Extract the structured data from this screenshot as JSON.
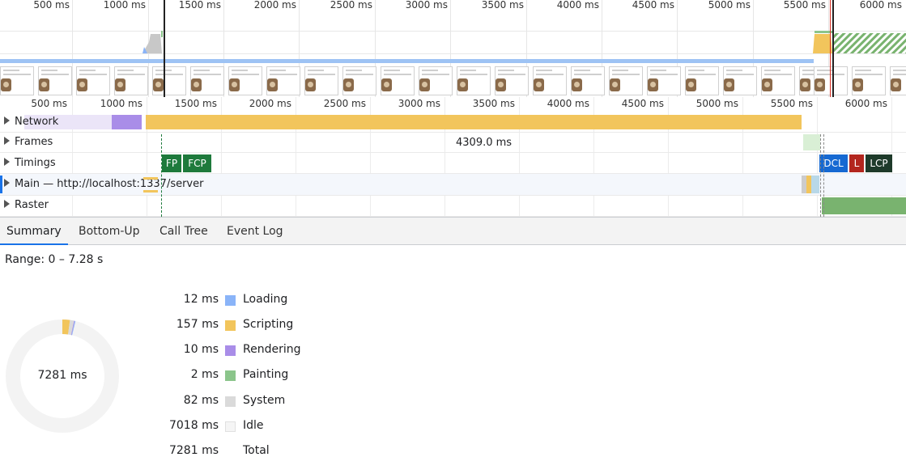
{
  "overview": {
    "ticks": [
      "500 ms",
      "1000 ms",
      "1500 ms",
      "2000 ms",
      "2500 ms",
      "3000 ms",
      "3500 ms",
      "4000 ms",
      "4500 ms",
      "5000 ms",
      "5500 ms",
      "6000 ms"
    ]
  },
  "ruler": {
    "ticks": [
      "500 ms",
      "1000 ms",
      "1500 ms",
      "2000 ms",
      "2500 ms",
      "3000 ms",
      "3500 ms",
      "4000 ms",
      "4500 ms",
      "5000 ms",
      "5500 ms",
      "6000 ms"
    ]
  },
  "tracks": {
    "network": "Network",
    "frames": "Frames",
    "frames_duration": "4309.0 ms",
    "timings": "Timings",
    "main": "Main — http://localhost:1337/server",
    "raster": "Raster"
  },
  "markers": {
    "fp": "FP",
    "fcp": "FCP",
    "dcl": "DCL",
    "l": "L",
    "lcp": "LCP"
  },
  "colors": {
    "loading": "#8ab4f8",
    "scripting": "#f2c55c",
    "rendering": "#a98de8",
    "painting": "#8bc58b",
    "system": "#dadada",
    "idle": "#f5f5f5",
    "fp": "#1e7a3c",
    "dcl": "#1669d2",
    "l": "#b3261e",
    "lcp": "#1e3a2a"
  },
  "tabs": [
    "Summary",
    "Bottom-Up",
    "Call Tree",
    "Event Log"
  ],
  "summary": {
    "range": "Range: 0 – 7.28 s",
    "donut_center": "7281 ms",
    "rows": [
      {
        "value": "12 ms",
        "label": "Loading"
      },
      {
        "value": "157 ms",
        "label": "Scripting"
      },
      {
        "value": "10 ms",
        "label": "Rendering"
      },
      {
        "value": "2 ms",
        "label": "Painting"
      },
      {
        "value": "82 ms",
        "label": "System"
      },
      {
        "value": "7018 ms",
        "label": "Idle"
      },
      {
        "value": "7281 ms",
        "label": "Total"
      }
    ]
  }
}
